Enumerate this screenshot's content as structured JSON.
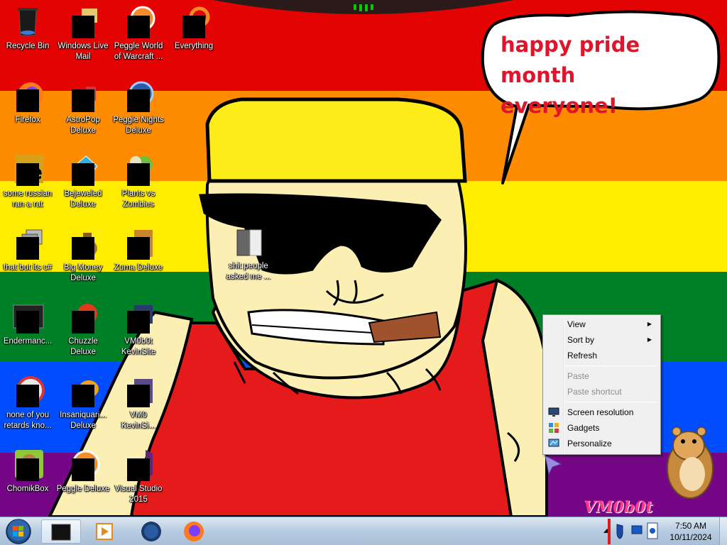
{
  "desktop": {
    "speech_bubble": {
      "line1": "happy pride month",
      "line2": "everyone!"
    },
    "watermark": "VM0b0t",
    "flag_colors": [
      "#e40303",
      "#ff8c00",
      "#ffed00",
      "#008026",
      "#004dff",
      "#750787"
    ],
    "icons": [
      {
        "label": "Recycle Bin",
        "icon": "recycle-bin-icon"
      },
      {
        "label": "Windows Live\nMail",
        "icon": "mail-icon"
      },
      {
        "label": "Peggle World\nof Warcraft ...",
        "icon": "peggle-icon"
      },
      {
        "label": "Everything",
        "icon": "search-icon"
      },
      {
        "label": "Firefox",
        "icon": "firefox-icon"
      },
      {
        "label": "AstroPop\nDeluxe",
        "icon": "astropop-icon"
      },
      {
        "label": "Peggle Nights\nDeluxe",
        "icon": "peggle-nights-icon"
      },
      {
        "label": "some russian\nran a rat",
        "icon": "app-icon"
      },
      {
        "label": "Bejeweled\nDeluxe",
        "icon": "gem-icon"
      },
      {
        "label": "Plants vs\nZombies",
        "icon": "plant-icon"
      },
      {
        "label": "that but its c#",
        "icon": "window-icon"
      },
      {
        "label": "Big Money\nDeluxe",
        "icon": "money-bag-icon"
      },
      {
        "label": "Zuma Deluxe",
        "icon": "zuma-icon"
      },
      {
        "label": "Endermanc...",
        "icon": "terminal-icon"
      },
      {
        "label": "Chuzzle\nDeluxe",
        "icon": "chuzzle-icon"
      },
      {
        "label": "VM0b0t\nKevinSite",
        "icon": "website-icon"
      },
      {
        "label": "none of you\nretards kno...",
        "icon": "disc-icon"
      },
      {
        "label": "Insaniquari...\nDeluxe",
        "icon": "fish-icon"
      },
      {
        "label": "VM0\nKevinSi...",
        "icon": "website-icon"
      },
      {
        "label": "ChomikBox",
        "icon": "hamster-icon"
      },
      {
        "label": "Peggle Deluxe",
        "icon": "peggle-icon"
      },
      {
        "label": "Visual Studio\n2015",
        "icon": "visual-studio-icon"
      },
      {
        "label": "shit people\nasked me ...",
        "icon": "folder-icon"
      }
    ]
  },
  "context_menu": {
    "view": "View",
    "sort_by": "Sort by",
    "refresh": "Refresh",
    "paste": "Paste",
    "paste_shortcut": "Paste shortcut",
    "screen_resolution": "Screen resolution",
    "gadgets": "Gadgets",
    "personalize": "Personalize",
    "submenu_arrow": "▶"
  },
  "taskbar": {
    "pinned": [
      {
        "icon": "file-explorer-icon"
      },
      {
        "icon": "media-player-icon"
      },
      {
        "icon": "globe-icon"
      },
      {
        "icon": "firefox-icon"
      }
    ],
    "clock": {
      "time": "7:50 AM",
      "date": "10/11/2024"
    }
  }
}
